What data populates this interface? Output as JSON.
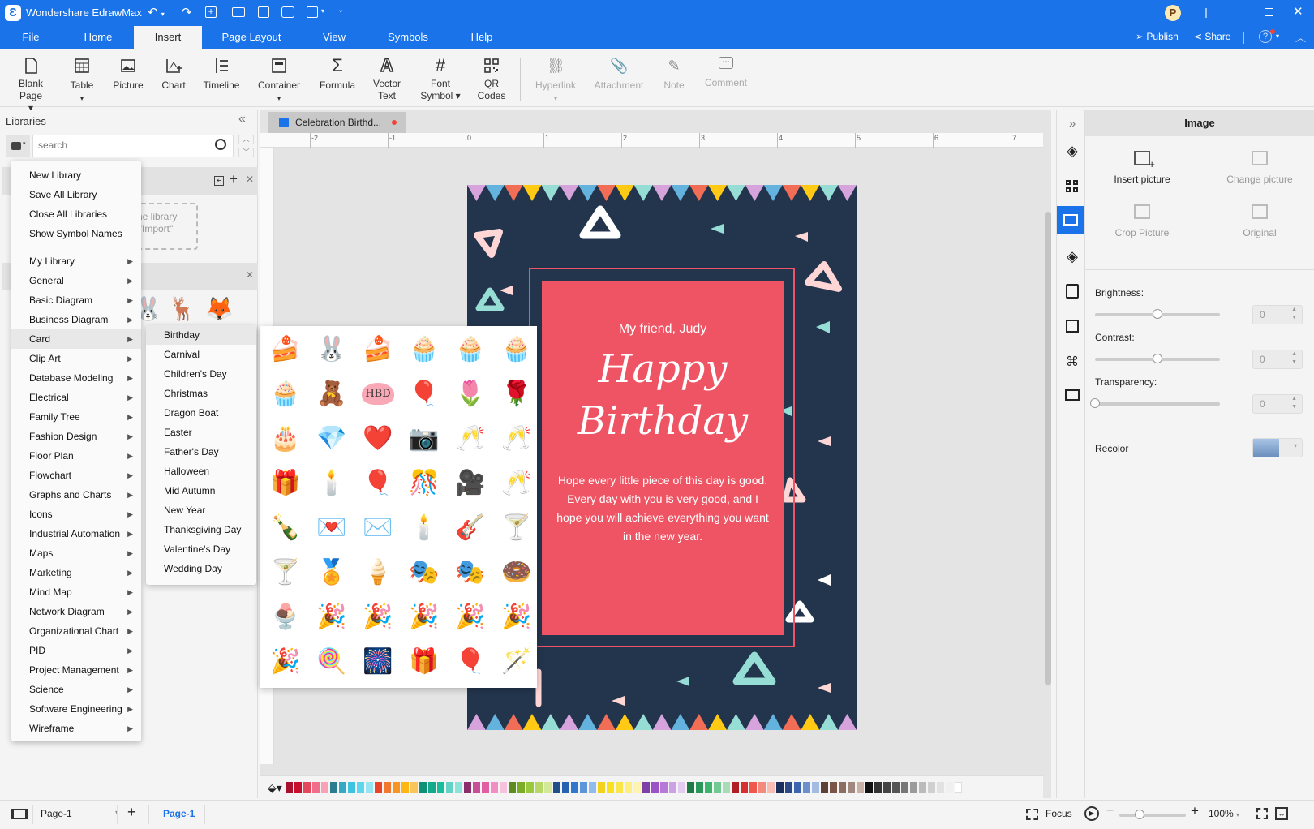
{
  "app": {
    "title": "Wondershare EdrawMax",
    "avatar_initial": "P"
  },
  "menubar": {
    "tabs": [
      "File",
      "Home",
      "Insert",
      "Page Layout",
      "View",
      "Symbols",
      "Help"
    ],
    "active_tab": "Insert",
    "publish": "Publish",
    "share": "Share"
  },
  "ribbon": {
    "buttons": [
      {
        "label": "Blank\nPage",
        "l1": "Blank",
        "l2": "Page ▾",
        "icon": "blank-page-icon"
      },
      {
        "label": "Table",
        "l1": "Table",
        "l2": "▾",
        "icon": "table-icon"
      },
      {
        "label": "Picture",
        "l1": "Picture",
        "l2": "",
        "icon": "picture-icon"
      },
      {
        "label": "Chart",
        "l1": "Chart",
        "l2": "",
        "icon": "chart-icon"
      },
      {
        "label": "Timeline",
        "l1": "Timeline",
        "l2": "",
        "icon": "timeline-icon"
      },
      {
        "label": "Container",
        "l1": "Container",
        "l2": "▾",
        "icon": "container-icon"
      },
      {
        "label": "Formula",
        "l1": "Formula",
        "l2": "",
        "icon": "formula-icon"
      },
      {
        "label": "Vector Text",
        "l1": "Vector",
        "l2": "Text",
        "icon": "vector-text-icon"
      },
      {
        "label": "Font Symbol",
        "l1": "Font",
        "l2": "Symbol ▾",
        "icon": "font-symbol-icon"
      },
      {
        "label": "QR Codes",
        "l1": "QR",
        "l2": "Codes",
        "icon": "qr-code-icon"
      },
      {
        "label": "Hyperlink",
        "l1": "Hyperlink",
        "l2": "▾",
        "icon": "hyperlink-icon",
        "disabled": true
      },
      {
        "label": "Attachment",
        "l1": "Attachment",
        "l2": "",
        "icon": "attachment-icon",
        "disabled": true
      },
      {
        "label": "Note",
        "l1": "Note",
        "l2": "",
        "icon": "note-icon",
        "disabled": true
      },
      {
        "label": "Comment",
        "l1": "Comment",
        "l2": "",
        "icon": "comment-icon",
        "disabled": true
      }
    ]
  },
  "libraries": {
    "title": "Libraries",
    "search_placeholder": "search",
    "import_hint_l1": "the library",
    "import_hint_l2": "\"Import\""
  },
  "library_menu": {
    "top_items": [
      "New Library",
      "Save All Library",
      "Close All Libraries",
      "Show Symbol Names"
    ],
    "categories": [
      "My Library",
      "General",
      "Basic Diagram",
      "Business Diagram",
      "Card",
      "Clip Art",
      "Database Modeling",
      "Electrical",
      "Family Tree",
      "Fashion Design",
      "Floor Plan",
      "Flowchart",
      "Graphs and Charts",
      "Icons",
      "Industrial Automation",
      "Maps",
      "Marketing",
      "Mind Map",
      "Network Diagram",
      "Organizational Chart",
      "PID",
      "Project Management",
      "Science",
      "Software Engineering",
      "Wireframe"
    ],
    "highlighted": "Card"
  },
  "card_submenu": {
    "items": [
      "Birthday",
      "Carnival",
      "Children's Day",
      "Christmas",
      "Dragon Boat",
      "Easter",
      "Father's Day",
      "Halloween",
      "Mid Autumn",
      "New Year",
      "Thanksgiving Day",
      "Valentine's Day",
      "Wedding Day"
    ],
    "highlighted": "Birthday"
  },
  "symbol_preview": {
    "rows": [
      [
        "🍰",
        "🐰",
        "🍰",
        "🧁",
        "🧁",
        "🧁"
      ],
      [
        "🧁",
        "🧸",
        "HBD",
        "🎈",
        "🌷",
        "🌹"
      ],
      [
        "🎂",
        "💎",
        "❤️",
        "📷",
        "🥂",
        "🥂"
      ],
      [
        "🎁",
        "🕯️",
        "🎈",
        "🎊",
        "🎥",
        "🥂"
      ],
      [
        "🍾",
        "💌",
        "✉️",
        "🕯️",
        "🎸",
        "🍸"
      ],
      [
        "🍸",
        "🏅",
        "🍦",
        "🎭",
        "🎭",
        "🍩"
      ],
      [
        "🍨",
        "🎉",
        "🎉",
        "🎉",
        "🎉",
        "🎉"
      ],
      [
        "🎉",
        "🍭",
        "🎆",
        "🎁",
        "🎈",
        "🪄"
      ]
    ]
  },
  "document": {
    "tab_title": "Celebration Birthd...",
    "ruler_labels": [
      "-2",
      "-1",
      "0",
      "1",
      "2",
      "3",
      "4",
      "5",
      "6",
      "7"
    ],
    "card": {
      "greeting": "My friend, Judy",
      "headline_1": "Happy",
      "headline_2": "Birthday",
      "message_1": "Hope every little piece of this day is good.",
      "message_2": "Every day with you is very good, and I hope you will achieve everything you want in the new year."
    },
    "colors": {
      "card_bg": "#23354d",
      "inner_bg": "#ee5463",
      "bunting": [
        "#d6a3dc",
        "#63b3de",
        "#f26d55",
        "#ffc914",
        "#96ddd6"
      ]
    }
  },
  "right_panel": {
    "title": "Image",
    "actions": [
      {
        "label": "Insert picture",
        "enabled": true
      },
      {
        "label": "Change picture",
        "enabled": false
      },
      {
        "label": "Crop Picture",
        "enabled": false
      },
      {
        "label": "Original",
        "enabled": false
      }
    ],
    "brightness": {
      "label": "Brightness:",
      "value": "0",
      "fraction": 0.5
    },
    "contrast": {
      "label": "Contrast:",
      "value": "0",
      "fraction": 0.5
    },
    "transparency": {
      "label": "Transparency:",
      "value": "0",
      "fraction": 0
    },
    "recolor": {
      "label": "Recolor"
    }
  },
  "palette": [
    "#a8102b",
    "#c8102e",
    "#e5475f",
    "#f06e8b",
    "#f7a3b5",
    "#2a7d8e",
    "#35a9c3",
    "#3cc3e0",
    "#5dd5ee",
    "#95e5f3",
    "#e8442c",
    "#f2772f",
    "#f79520",
    "#fdb714",
    "#f8c55b",
    "#109176",
    "#14a98a",
    "#19bd9c",
    "#62d3c4",
    "#8ee3d9",
    "#8c2e6b",
    "#c74f97",
    "#e25ea3",
    "#f18ec3",
    "#f6c2dc",
    "#5c8d1c",
    "#7aad23",
    "#98c93c",
    "#b7d866",
    "#d4e89a",
    "#204f8a",
    "#2662b0",
    "#3377cc",
    "#5b96db",
    "#91bbea",
    "#f2d21d",
    "#fae11e",
    "#fbe64a",
    "#fdee7e",
    "#fef4b2",
    "#7f3fa8",
    "#9a52c4",
    "#b779d8",
    "#cda2e4",
    "#e4ccf0",
    "#1f7a48",
    "#29985a",
    "#3db56f",
    "#73c993",
    "#a8dcb7",
    "#b01f24",
    "#d62f2e",
    "#ed5a4d",
    "#f38a7d",
    "#f9bdb3",
    "#1b2f5e",
    "#2a4a8a",
    "#3c66b1",
    "#6d8fcc",
    "#a5bce2",
    "#5d4037",
    "#795548",
    "#8d6e63",
    "#a1887f",
    "#c8b2a6",
    "#111111",
    "#333333",
    "#444444",
    "#555555",
    "#777777",
    "#9b9b9b",
    "#bbbbbb",
    "#d0d0d0",
    "#e2e2e2",
    "#f0f0f0",
    "#ffffff"
  ],
  "statusbar": {
    "page_select": "Page-1",
    "page_tab": "Page-1",
    "focus": "Focus",
    "zoom": "100%",
    "zoom_fraction": 0.3
  },
  "accent": "#1a73e8"
}
